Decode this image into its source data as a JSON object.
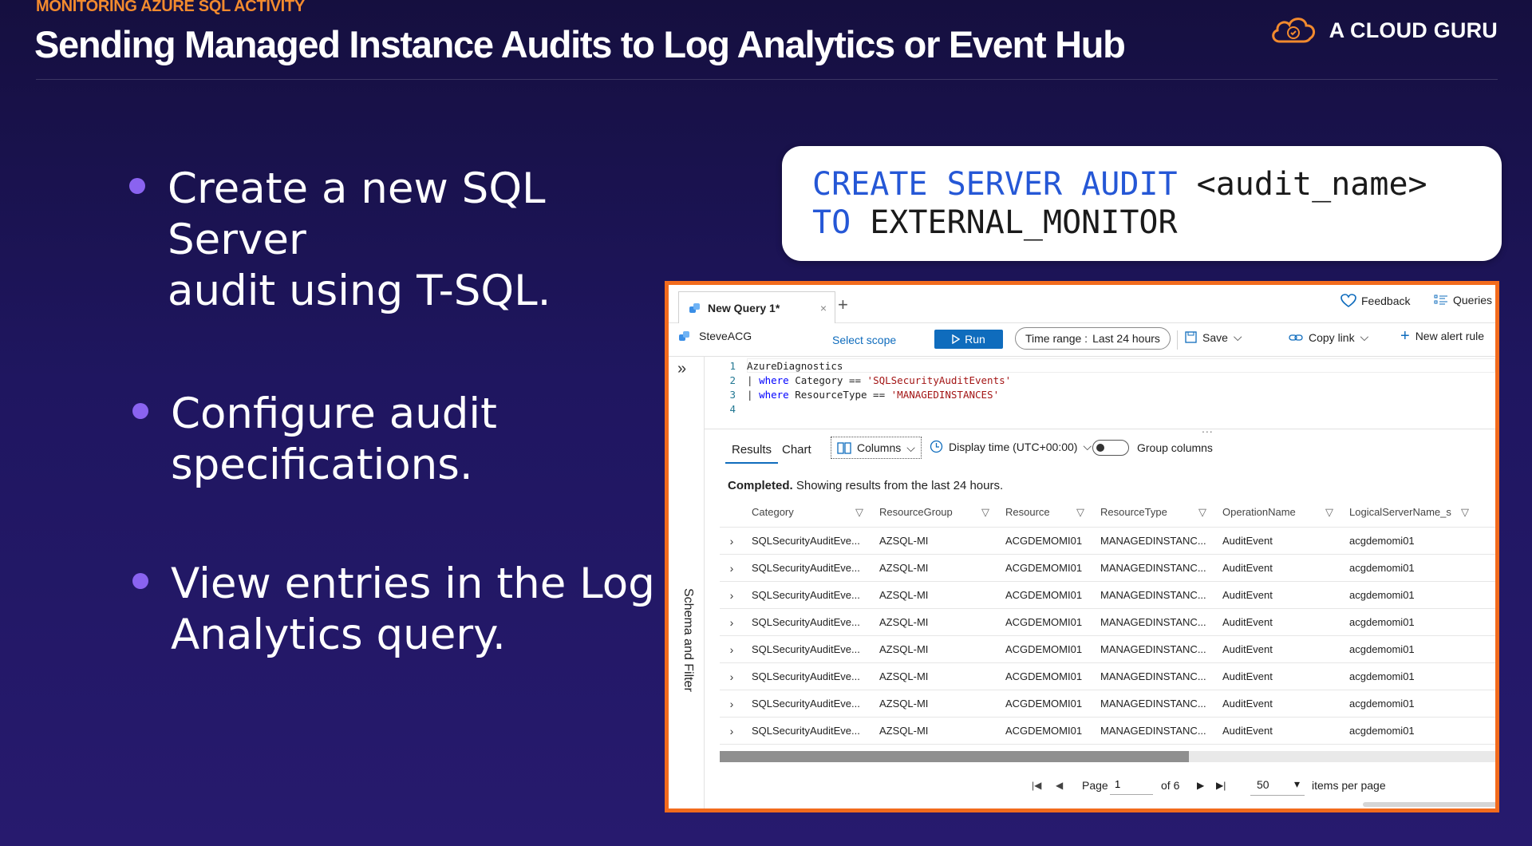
{
  "slide": {
    "eyebrow": "MONITORING AZURE SQL ACTIVITY",
    "title": "Sending Managed Instance Audits to Log Analytics or Event Hub",
    "logo_text": "A CLOUD GURU",
    "accent_color": "#f26b1d",
    "bullets": [
      {
        "line1": "Create a new SQL Server",
        "line2": "audit using T-SQL."
      },
      {
        "line1": "Configure audit",
        "line2": "specifications."
      },
      {
        "line1": "View entries in the Log",
        "line2": "Analytics query."
      }
    ],
    "code": {
      "line1_keywords": "CREATE SERVER AUDIT",
      "line1_rest": " <audit_name>",
      "line2_keyword": "TO",
      "line2_rest": " EXTERNAL_MONITOR"
    }
  },
  "portal": {
    "tab_label": "New Query 1*",
    "tab_close": "×",
    "new_tab": "+",
    "feedback": "Feedback",
    "queries": "Queries",
    "workspace": "SteveACG",
    "select_scope": "Select scope",
    "run": "Run",
    "time_range_label": "Time range :",
    "time_range_value": "Last 24 hours",
    "save": "Save",
    "copy_link": "Copy link",
    "new_alert_rule": "New alert rule",
    "sidebar_label": "Schema and Filter",
    "editor": {
      "line_numbers": [
        "1",
        "2",
        "3",
        "4"
      ],
      "table": "AzureDiagnostics",
      "pipe": "|",
      "where": "where",
      "cond1_field": " Category == ",
      "cond1_value": "'SQLSecurityAuditEvents'",
      "cond2_field": " ResourceType == ",
      "cond2_value": "'MANAGEDINSTANCES'"
    },
    "splitter": "...",
    "results_tab": "Results",
    "chart_tab": "Chart",
    "columns": "Columns",
    "display_time": "Display time (UTC+00:00)",
    "group_columns": "Group columns",
    "status_bold": "Completed.",
    "status_text": " Showing results from the last 24 hours.",
    "table": {
      "headers": [
        "Category",
        "ResourceGroup",
        "Resource",
        "ResourceType",
        "OperationName",
        "LogicalServerName_s"
      ],
      "rows": [
        [
          "SQLSecurityAuditEve...",
          "AZSQL-MI",
          "ACGDEMOMI01",
          "MANAGEDINSTANC...",
          "AuditEvent",
          "acgdemomi01"
        ],
        [
          "SQLSecurityAuditEve...",
          "AZSQL-MI",
          "ACGDEMOMI01",
          "MANAGEDINSTANC...",
          "AuditEvent",
          "acgdemomi01"
        ],
        [
          "SQLSecurityAuditEve...",
          "AZSQL-MI",
          "ACGDEMOMI01",
          "MANAGEDINSTANC...",
          "AuditEvent",
          "acgdemomi01"
        ],
        [
          "SQLSecurityAuditEve...",
          "AZSQL-MI",
          "ACGDEMOMI01",
          "MANAGEDINSTANC...",
          "AuditEvent",
          "acgdemomi01"
        ],
        [
          "SQLSecurityAuditEve...",
          "AZSQL-MI",
          "ACGDEMOMI01",
          "MANAGEDINSTANC...",
          "AuditEvent",
          "acgdemomi01"
        ],
        [
          "SQLSecurityAuditEve...",
          "AZSQL-MI",
          "ACGDEMOMI01",
          "MANAGEDINSTANC...",
          "AuditEvent",
          "acgdemomi01"
        ],
        [
          "SQLSecurityAuditEve...",
          "AZSQL-MI",
          "ACGDEMOMI01",
          "MANAGEDINSTANC...",
          "AuditEvent",
          "acgdemomi01"
        ],
        [
          "SQLSecurityAuditEve...",
          "AZSQL-MI",
          "ACGDEMOMI01",
          "MANAGEDINSTANC...",
          "AuditEvent",
          "acgdemomi01"
        ]
      ]
    },
    "pager": {
      "page_label": "Page",
      "page_value": "1",
      "of_label": "of 6",
      "page_size": "50",
      "per_page_label": "items per page"
    }
  }
}
